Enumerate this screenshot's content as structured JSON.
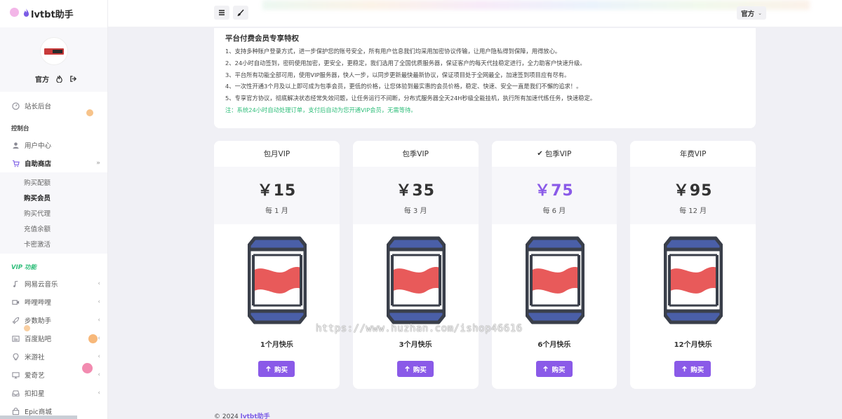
{
  "app": {
    "name": "lvtbt助手"
  },
  "profile": {
    "name": "官方"
  },
  "topbar": {
    "lang": "官方"
  },
  "sidebar": {
    "admin_item": "站长后台",
    "section_console": "控制台",
    "user_center": "用户中心",
    "shop": "自助商店",
    "shop_sub": [
      "购买配额",
      "购买会员",
      "购买代理",
      "充值余额",
      "卡密激活"
    ],
    "section_vip": "VIP 功能",
    "vip_items": [
      "网易云音乐",
      "哔哩哔哩",
      "步数助手",
      "百度贴吧",
      "米游社",
      "爱奇艺",
      "扣扣星",
      "Epic商城"
    ]
  },
  "info": {
    "title": "平台付费会员专享特权",
    "lines": [
      "1、支持多种账户登录方式，进一步保护您的账号安全，所有用户信息我们均采用加密协议传输，让用户隐私得到保障，用得放心。",
      "2、24小时自动签到，密码使用加密，更安全，更稳定，我们选用了全国优质服务器，保证客户的每天代挂稳定进行，全力助客户快速升级。",
      "3、平台所有功能全部可用，使用VIP服务器，快人一步，以同步更新最快最新协议，保证项目处于全网最全，加速签到项目应有尽有。",
      "4、一次性开通3个月及以上即可成为包季会员，更低的价格，让您体验到最实惠的会员价格，稳定、快速、安全一直是我们不懈的追求！。",
      "5、专享官方协议，彻底解决状态经常失效问题，让任务运行不间断，分布式服务器全天24H秒级全能挂机，执行所有加速代练任务，快速稳定。"
    ],
    "note": "注：系统24小时自动处理订单，支付后自动为您开通VIP会员，无需等待。"
  },
  "plans": [
    {
      "name": "包月VIP",
      "price": "￥15",
      "period": "每 1 月",
      "tagline": "1个月快乐",
      "buy": "购买",
      "selected": false
    },
    {
      "name": "包季VIP",
      "price": "￥35",
      "period": "每 3 月",
      "tagline": "3个月快乐",
      "buy": "购买",
      "selected": false
    },
    {
      "name": "包季VIP",
      "price": "￥75",
      "period": "每 6 月",
      "tagline": "6个月快乐",
      "buy": "购买",
      "selected": true
    },
    {
      "name": "年费VIP",
      "price": "￥95",
      "period": "每 12 月",
      "tagline": "12个月快乐",
      "buy": "购买",
      "selected": false
    }
  ],
  "footer": {
    "prefix": "© 2024 ",
    "brand": "lvtbt助手"
  },
  "watermark": "https://www.huzhan.com/ishop46616",
  "colors": {
    "accent": "#8a5ae8",
    "note_green": "#2fbe7a",
    "can_blue": "#4a5fa8",
    "can_red": "#e85a5a",
    "can_outline": "#3a3f4a"
  }
}
